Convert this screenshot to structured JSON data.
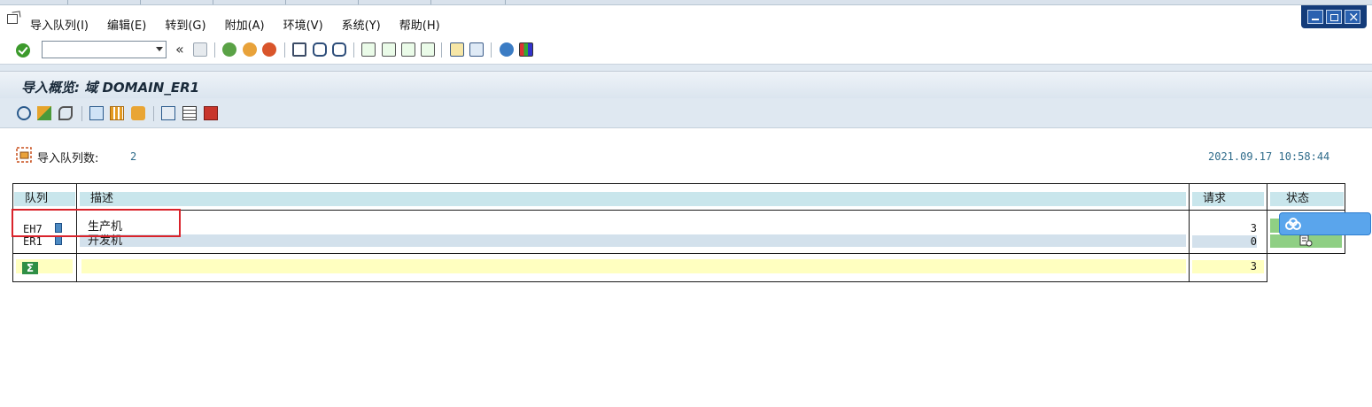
{
  "menu": {
    "items": [
      "导入队列(I)",
      "编辑(E)",
      "转到(G)",
      "附加(A)",
      "环境(V)",
      "系统(Y)",
      "帮助(H)"
    ]
  },
  "toolbar": {
    "command_field_value": "",
    "history_glyph": "«"
  },
  "page": {
    "title": "导入概览: 域 DOMAIN_ER1"
  },
  "summary": {
    "label": "导入队列数:",
    "count": "2",
    "timestamp": "2021.09.17 10:58:44"
  },
  "table": {
    "headers": {
      "queue": "队列",
      "description": "描述",
      "requests": "请求",
      "status": "状态"
    },
    "rows": [
      {
        "queue": "EH7",
        "description": "生产机",
        "requests": "3"
      },
      {
        "queue": "ER1",
        "description": "开发机",
        "requests": "0"
      }
    ],
    "total": {
      "requests": "3"
    },
    "sigma_glyph": "Σ"
  },
  "colors": {
    "header_bg": "#c9e6ec",
    "sum_row_bg": "#ffffc0",
    "status_ok": "#8fcf84",
    "highlight_box": "#d9232b",
    "accent_text": "#2e6b8a"
  }
}
